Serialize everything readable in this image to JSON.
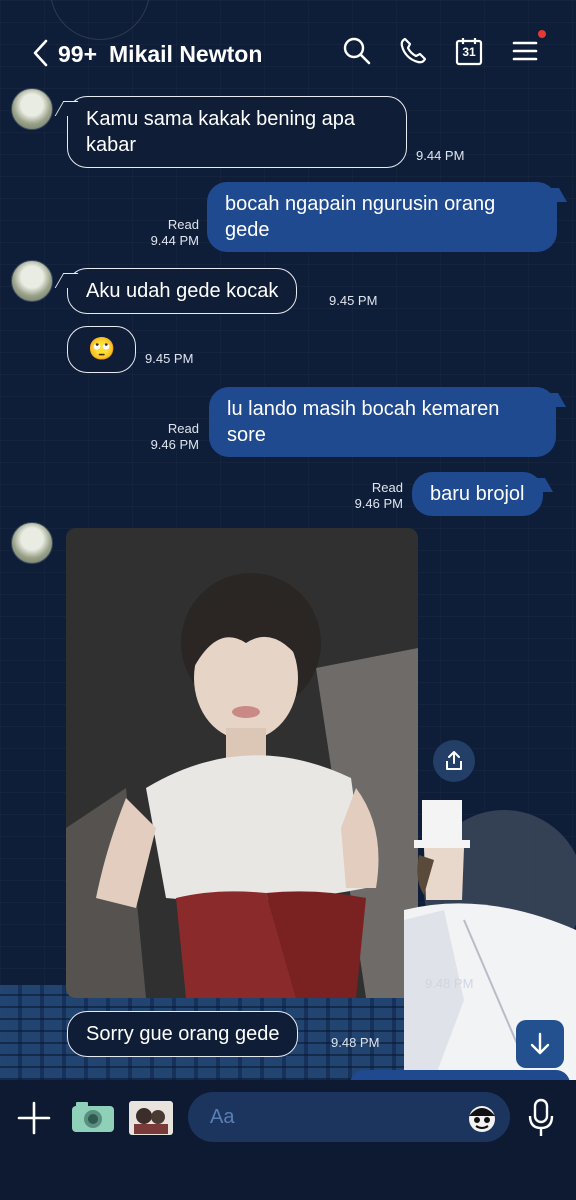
{
  "header": {
    "back_icon": "chevron-left-icon",
    "unread_count": "99+",
    "contact_name": "Mikail Newton",
    "icons": [
      "search-icon",
      "phone-icon",
      "calendar-icon",
      "menu-icon"
    ],
    "calendar_day": "31"
  },
  "messages": [
    {
      "from": "them",
      "text_line1": "Kamu sama kakak bening apa",
      "text_line2": "kabar",
      "time": "9.44 PM"
    },
    {
      "from": "me",
      "text_line1": "bocah ngapain ngurusin orang",
      "text_line2": "gede",
      "status": "Read",
      "time": "9.44 PM"
    },
    {
      "from": "them",
      "text": "Aku udah gede kocak",
      "time": "9.45 PM"
    },
    {
      "from": "them",
      "text": "🙄",
      "time": "9.45 PM"
    },
    {
      "from": "me",
      "text_line1": "lu lando masih bocah kemaren",
      "text_line2": "sore",
      "status": "Read",
      "time": "9.46 PM"
    },
    {
      "from": "me",
      "text": "baru brojol",
      "status": "Read",
      "time": "9.46 PM"
    },
    {
      "from": "them",
      "type": "photo"
    },
    {
      "from": "them",
      "text": "Sorry gue orang gede",
      "time": "9.48 PM"
    }
  ],
  "input": {
    "placeholder": "Aa"
  },
  "colors": {
    "background": "#0f1d36",
    "outgoing_bubble": "#1f4a8f",
    "input_bg": "#1c355e"
  }
}
